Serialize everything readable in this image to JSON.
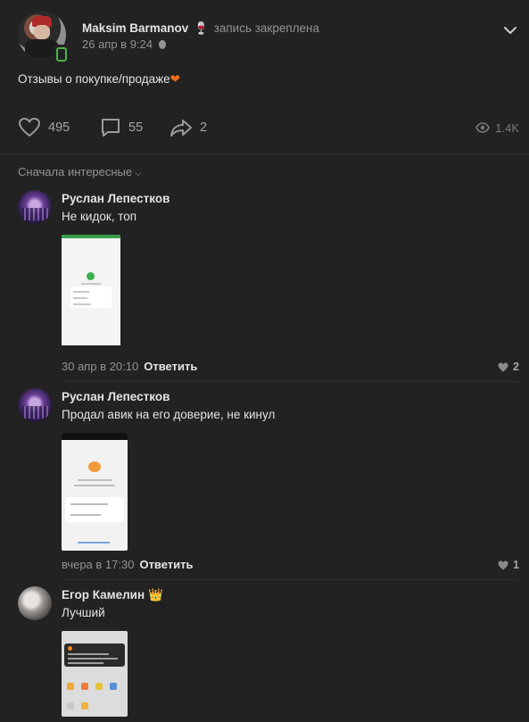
{
  "post": {
    "author": "Maksim Barmanov",
    "author_emoji": "🍷",
    "pinned_label": "запись закреплена",
    "date": "26 апр в 9:24",
    "text": "Отзывы о покупке/продаже",
    "text_emoji": "❤",
    "likes": "495",
    "comments": "55",
    "shares": "2",
    "views": "1.4K"
  },
  "sort_label": "Сначала интересные",
  "comments": [
    {
      "name": "Руслан Лепестков",
      "text": "Не кидок, топ",
      "date": "30 апр в 20:10",
      "reply": "Ответить",
      "likes": "2"
    },
    {
      "name": "Руслан Лепестков",
      "text": "Продал авик на его доверие, не кинул",
      "date": "вчера в 17:30",
      "reply": "Ответить",
      "likes": "1"
    },
    {
      "name": "Егор Камелин",
      "badge": "👑",
      "text": "Лучший"
    }
  ],
  "colors": {
    "background": "#222223",
    "text": "#e1e3e6",
    "secondary": "#939393",
    "heart_emoji": "#f26b1f",
    "crown": "#e3b32b"
  }
}
